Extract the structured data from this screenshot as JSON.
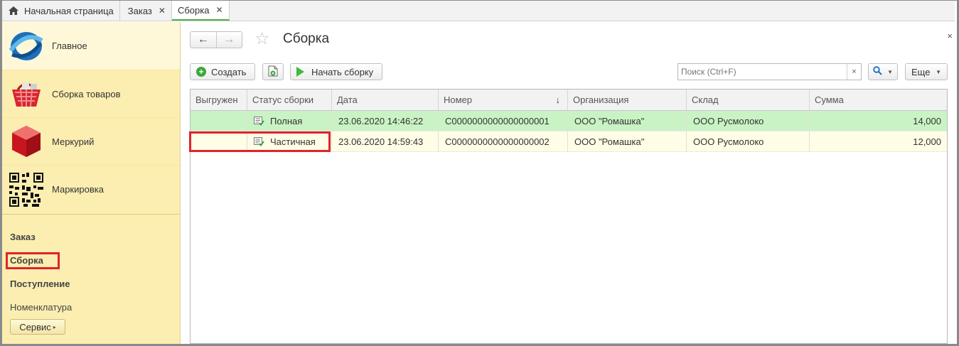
{
  "tabs": [
    {
      "label": "Начальная страница",
      "icon": "home-icon",
      "closable": false,
      "active": false
    },
    {
      "label": "Заказ",
      "icon": null,
      "closable": true,
      "active": false
    },
    {
      "label": "Сборка",
      "icon": null,
      "closable": true,
      "active": true
    }
  ],
  "sidebar": {
    "sections": [
      {
        "label": "Главное",
        "icon": "main-logo-icon"
      },
      {
        "label": "Сборка товаров",
        "icon": "basket-icon"
      },
      {
        "label": "Меркурий",
        "icon": "red-cube-icon"
      },
      {
        "label": "Маркировка",
        "icon": "qr-code-icon"
      }
    ],
    "nav": [
      "Заказ",
      "Сборка",
      "Поступление",
      "Номенклатура"
    ],
    "service_label": "Сервис",
    "highlight_color": "#e0232b"
  },
  "page": {
    "title": "Сборка",
    "back_arrow": "←",
    "forward_arrow": "→",
    "close_symbol": "×"
  },
  "toolbar": {
    "create_label": "Создать",
    "start_label": "Начать сборку",
    "search_placeholder": "Поиск (Ctrl+F)",
    "clear_symbol": "×",
    "more_label": "Еще"
  },
  "table": {
    "columns": [
      "Выгружен",
      "Статус сборки",
      "Дата",
      "Номер",
      "Организация",
      "Склад",
      "Сумма"
    ],
    "sort_indicator": "↓",
    "rows": [
      {
        "uploaded": "",
        "status": "Полная",
        "date": "23.06.2020 14:46:22",
        "number": "С0000000000000000001",
        "org": "ООО \"Ромашка\"",
        "warehouse": "ООО Русмолоко",
        "sum": "14,000"
      },
      {
        "uploaded": "",
        "status": "Частичная",
        "date": "23.06.2020 14:59:43",
        "number": "С0000000000000000002",
        "org": "ООО \"Ромашка\"",
        "warehouse": "ООО Русмолоко",
        "sum": "12,000"
      }
    ]
  },
  "colors": {
    "sidebar_bg": "#fbeeb0",
    "row_full_bg": "#c9f3c4",
    "row_partial_bg": "#fefde6",
    "accent_green": "#4caf50"
  }
}
